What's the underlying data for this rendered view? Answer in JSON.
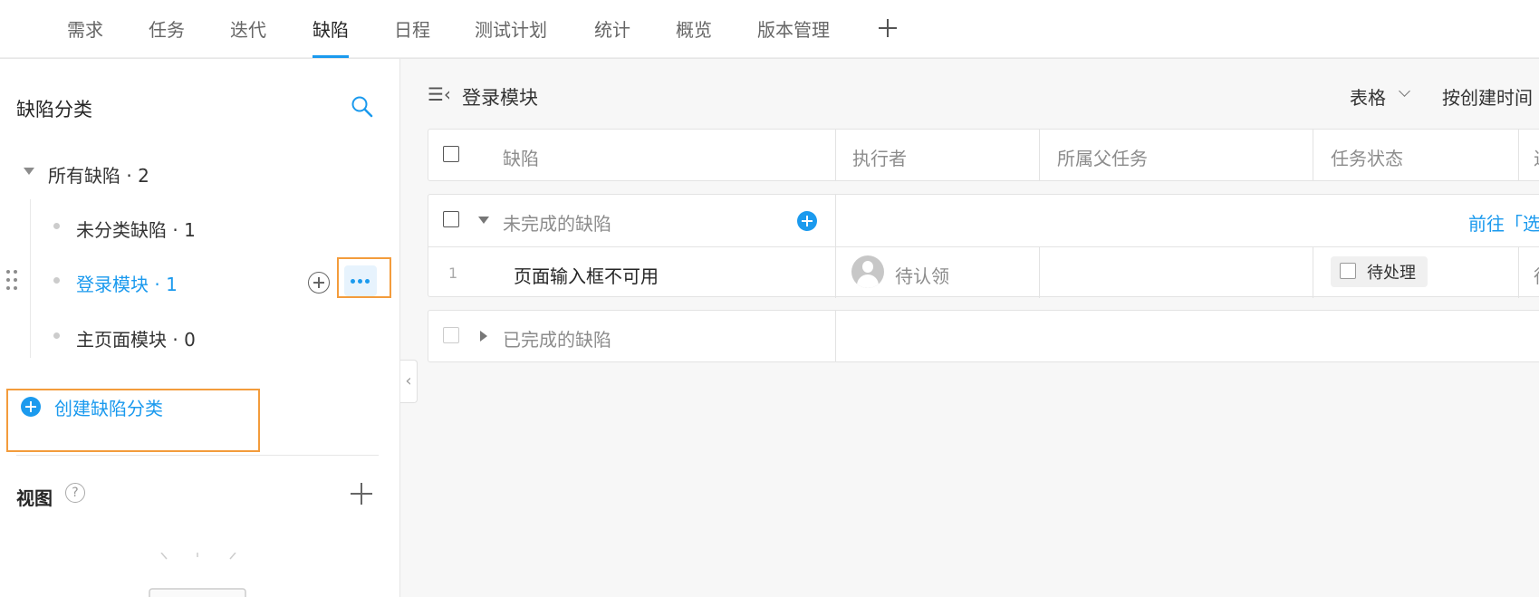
{
  "top_nav": {
    "tabs": [
      "需求",
      "任务",
      "迭代",
      "缺陷",
      "日程",
      "测试计划",
      "统计",
      "概览",
      "版本管理"
    ],
    "active_tab": "缺陷"
  },
  "sidebar": {
    "title": "缺陷分类",
    "root": {
      "label": "所有缺陷 · 2"
    },
    "items": [
      {
        "label": "未分类缺陷 · 1"
      },
      {
        "label": "登录模块 · 1",
        "active": true
      },
      {
        "label": "主页面模块 · 0"
      }
    ],
    "create_label": "创建缺陷分类",
    "view_title": "视图",
    "help_symbol": "?"
  },
  "main": {
    "fold_symbol": "☰‹",
    "breadcrumb": "登录模块",
    "view_mode": "表格",
    "sort_label": "按创建时间",
    "columns": [
      "缺陷",
      "执行者",
      "所属父任务",
      "任务状态",
      "进"
    ],
    "groups": [
      {
        "label": "未完成的缺陷",
        "link": "前往「选",
        "expanded": true
      },
      {
        "label": "已完成的缺陷",
        "expanded": false
      }
    ],
    "rows": [
      {
        "index": "1",
        "title": "页面输入框不可用",
        "assignee": "待认领",
        "parent_task": "",
        "status": "待处理",
        "next_col_clip": "待"
      }
    ]
  },
  "colors": {
    "accent": "#1b9aee",
    "highlight": "#f39c3c"
  }
}
